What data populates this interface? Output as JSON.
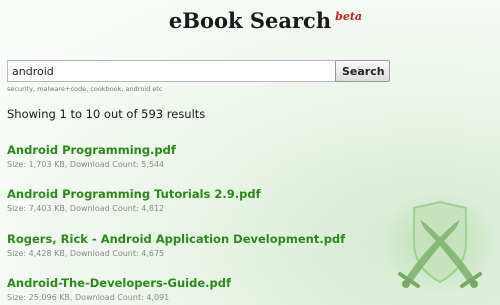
{
  "header": {
    "title": "eBook Search",
    "badge": "beta"
  },
  "search": {
    "value": "android",
    "button_label": "Search",
    "hint": "security, malware+code, cookbook, android etc"
  },
  "summary": "Showing 1 to 10 out of 593 results",
  "results": [
    {
      "title": "Android Programming.pdf",
      "meta": "Size: 1,703 KB, Download Count: 5,544"
    },
    {
      "title": "Android Programming Tutorials 2.9.pdf",
      "meta": "Size: 7,403 KB, Download Count: 4,812"
    },
    {
      "title": "Rogers, Rick - Android Application Development.pdf",
      "meta": "Size: 4,428 KB, Download Count: 4,675"
    },
    {
      "title": "Android-The-Developers-Guide.pdf",
      "meta": "Size: 25,096 KB, Download Count: 4,091"
    }
  ],
  "colors": {
    "link": "#2b8a1a",
    "badge": "#cc1b1b",
    "meta": "#8a8a8a"
  },
  "icons": {
    "watermark": "shield-crossed-swords-icon"
  }
}
